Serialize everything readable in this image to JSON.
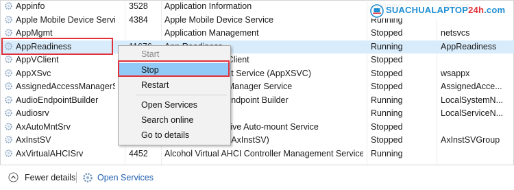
{
  "services": [
    {
      "name": "Appinfo",
      "pid": "3528",
      "description": "Application Information",
      "status": "Running",
      "group": "netsvcs"
    },
    {
      "name": "Apple Mobile Device Service",
      "pid": "4384",
      "description": "Apple Mobile Device Service",
      "status": "Running",
      "group": ""
    },
    {
      "name": "AppMgmt",
      "pid": "",
      "description": "Application Management",
      "status": "Stopped",
      "group": "netsvcs"
    },
    {
      "name": "AppReadiness",
      "pid": "11676",
      "description": "App Readiness",
      "status": "Running",
      "group": "AppReadiness"
    },
    {
      "name": "AppVClient",
      "pid": "",
      "description": "Microsoft App-V Client",
      "status": "Stopped",
      "group": ""
    },
    {
      "name": "AppXSvc",
      "pid": "",
      "description": "AppX Deployment Service (AppXSVC)",
      "status": "Stopped",
      "group": "wsappx"
    },
    {
      "name": "AssignedAccessManagerSvc",
      "pid": "",
      "description": "AssignedAccessManager Service",
      "status": "Stopped",
      "group": "AssignedAcce..."
    },
    {
      "name": "AudioEndpointBuilder",
      "pid": "",
      "description": "Windows Audio Endpoint Builder",
      "status": "Running",
      "group": "LocalSystemN..."
    },
    {
      "name": "Audiosrv",
      "pid": "",
      "description": "Windows Audio",
      "status": "Running",
      "group": "LocalServiceN..."
    },
    {
      "name": "AxAutoMntSrv",
      "pid": "",
      "description": "Alcohol Virtual Drive Auto-mount Service",
      "status": "Stopped",
      "group": ""
    },
    {
      "name": "AxInstSV",
      "pid": "",
      "description": "ActiveX Installer (AxInstSV)",
      "status": "Stopped",
      "group": "AxInstSVGroup"
    },
    {
      "name": "AxVirtualAHCISrv",
      "pid": "4452",
      "description": "Alcohol Virtual AHCI Controller Management Service",
      "status": "Running",
      "group": ""
    }
  ],
  "context_menu": {
    "start": "Start",
    "stop": "Stop",
    "restart": "Restart",
    "open_services": "Open Services",
    "search_online": "Search online",
    "go_to_details": "Go to details"
  },
  "footer": {
    "fewer_details": "Fewer details",
    "open_services": "Open Services"
  },
  "watermark": {
    "part1": "SUACHUALAPTOP",
    "part2": "24h",
    "part3": ".com"
  },
  "colors": {
    "selection": "#d9ecfb",
    "highlight_border": "#e2313a",
    "menu_active": "#91c9f7",
    "link": "#1f5fb0",
    "brand": "#1f8fd3"
  }
}
